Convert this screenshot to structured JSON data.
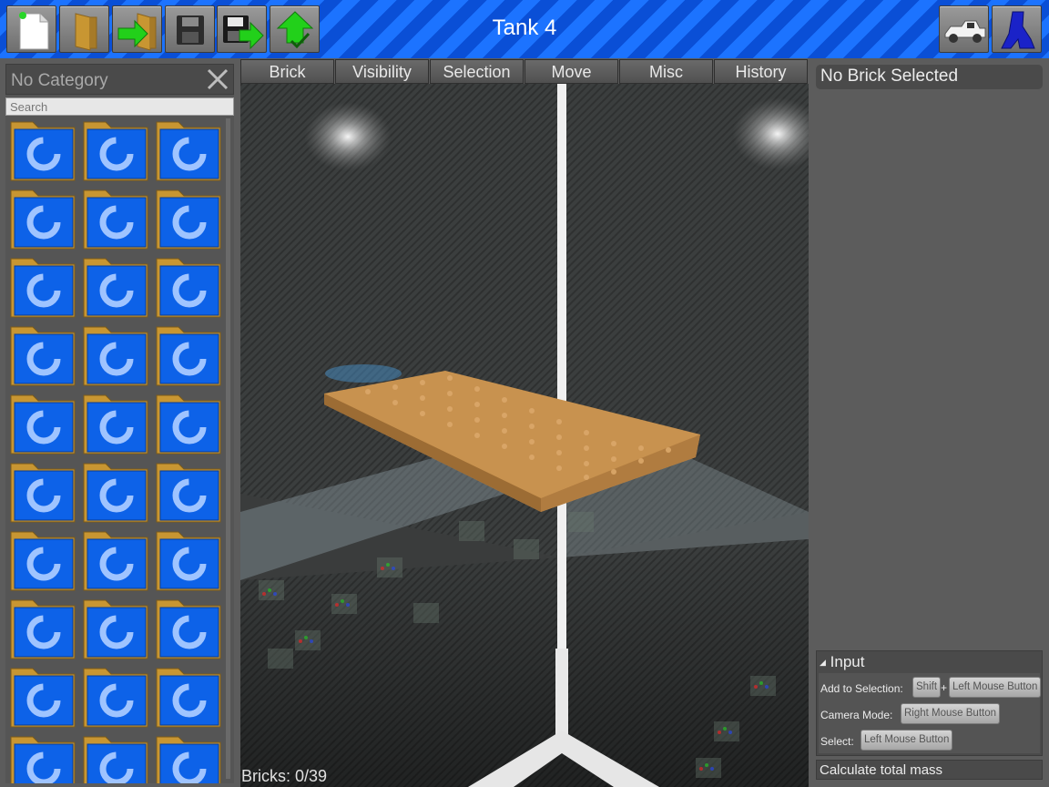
{
  "window": {
    "title": "Tank 4"
  },
  "toolbar": {
    "left_buttons": [
      "new-file-icon",
      "open-folder-icon",
      "import-icon",
      "save-icon",
      "save-as-icon",
      "upload-icon"
    ],
    "right_buttons": [
      "vehicle-icon",
      "character-icon"
    ]
  },
  "left_panel": {
    "category_label": "No Category",
    "search_placeholder": "Search",
    "folder_icon": "loading-folder-icon"
  },
  "tabs": [
    "Brick",
    "Visibility",
    "Selection",
    "Move",
    "Misc",
    "History"
  ],
  "viewport": {
    "status": "Bricks: 0/39"
  },
  "right_panel": {
    "selected_header": "No Brick Selected",
    "input": {
      "title": "Input",
      "add_to_selection_label": "Add to Selection:",
      "shift_key": "Shift",
      "plus": "+",
      "left_mouse_button": "Left Mouse Button",
      "camera_mode_label": "Camera Mode:",
      "right_mouse_button": "Right Mouse Button",
      "select_label": "Select:",
      "select_left_mouse_button": "Left Mouse Button"
    },
    "calc_mass_label": "Calculate total mass"
  },
  "colors": {
    "topbar_blue": "#0a4fd6",
    "topbar_stripe": "#1c73ff",
    "panel_gray": "#5c5c5c",
    "folder_orange": "#c89632",
    "folder_blue": "#0d62e8",
    "brick_tan": "#c8924f",
    "arrow_green": "#22d01a"
  }
}
